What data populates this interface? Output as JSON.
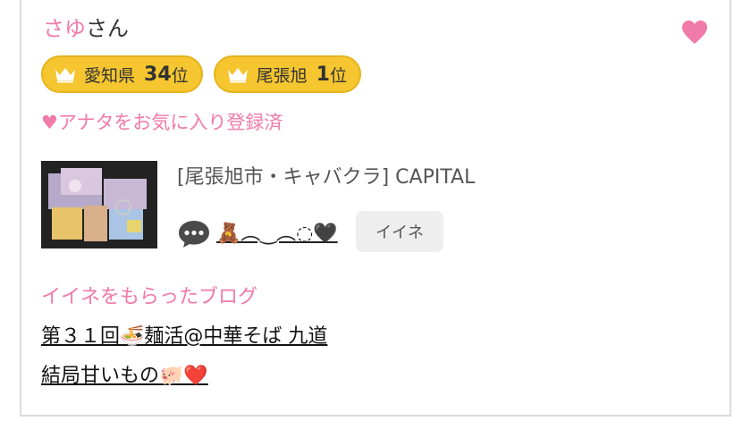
{
  "user": {
    "name": "さゆ",
    "suffix": "さん"
  },
  "favorite_button_icon": "heart-icon",
  "ranks": [
    {
      "area": "愛知県",
      "number": "34",
      "unit": "位"
    },
    {
      "area": "尾張旭",
      "number": "1",
      "unit": "位"
    }
  ],
  "favorite_status": "♥アナタをお気に入り登録済",
  "shop": {
    "name": "[尾張旭市・キャバクラ]  CAPITAL"
  },
  "status_message": "🧸︵‿︵◌🖤",
  "iine_button_label": "イイネ",
  "blog": {
    "heading": "イイネをもらったブログ",
    "posts": [
      {
        "title": "第３１回🍜麺活@中華そば 九道"
      },
      {
        "title": "結局甘いもの🐖❤️"
      }
    ]
  },
  "colors": {
    "pink": "#f07aa8",
    "rank_gold": "#f5c630",
    "button_gray": "#eeeeee"
  }
}
